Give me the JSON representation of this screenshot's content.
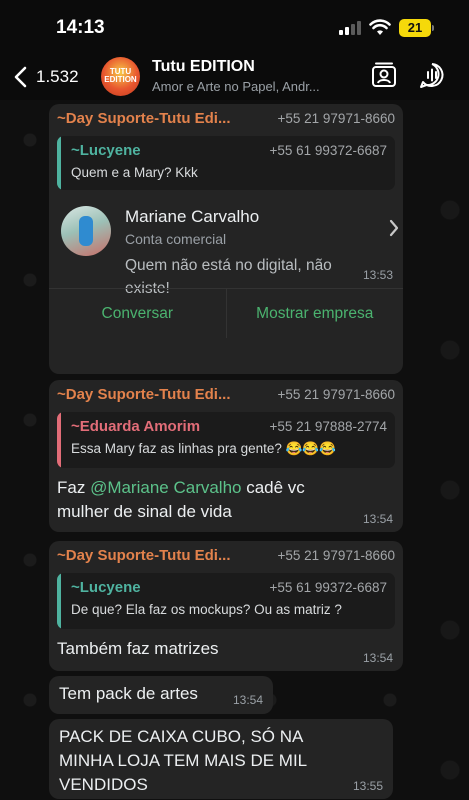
{
  "status": {
    "time": "14:13",
    "battery": "21"
  },
  "header": {
    "back_count": "1.532",
    "avatar_text": "TUTU EDITION",
    "title": "Tutu EDITION",
    "subtitle": "Amor e Arte no Papel, Andr..."
  },
  "messages": [
    {
      "sender": "~Day Suporte-Tutu Edi...",
      "phone": "+55 21 97971-8660",
      "quote": {
        "name": "~Lucyene",
        "phone": "+55 61 99372-6687",
        "text": "Quem e a Mary? Kkk",
        "color": "#4fb3a0"
      },
      "card": {
        "name": "Mariane Carvalho",
        "type": "Conta comercial",
        "desc": "Quem não está no digital, não existe!",
        "time": "13:53",
        "action_left": "Conversar",
        "action_right": "Mostrar empresa"
      }
    },
    {
      "sender": "~Day Suporte-Tutu Edi...",
      "phone": "+55 21 97971-8660",
      "quote": {
        "name": "~Eduarda Amorim",
        "phone": "+55 21 97888-2774",
        "text": "Essa Mary faz as linhas pra gente? 😂😂😂",
        "color": "#e26d78"
      },
      "text_prefix": "Faz ",
      "mention": "@Mariane Carvalho",
      "text_suffix": " cadê vc mulher de sinal de vida",
      "time": "13:54"
    },
    {
      "sender": "~Day Suporte-Tutu Edi...",
      "phone": "+55 21 97971-8660",
      "quote": {
        "name": "~Lucyene",
        "phone": "+55 61 99372-6687",
        "text": "De que? Ela faz os mockups? Ou as matriz ?",
        "color": "#4fb3a0"
      },
      "text": "Também faz matrizes",
      "time": "13:54"
    },
    {
      "text": "Tem pack de artes",
      "time": "13:54"
    },
    {
      "text": "PACK DE CAIXA CUBO, SÓ NA MINHA LOJA TEM MAIS DE MIL VENDIDOS",
      "time": "13:55"
    }
  ]
}
